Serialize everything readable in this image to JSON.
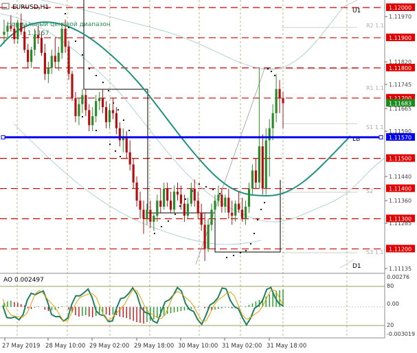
{
  "window": {
    "symbol_title": "EURUSD,H1",
    "indicator_line": "Нормальный ценовой диапазон",
    "price_readout": "1.1157"
  },
  "ao_panel": {
    "label": "AO 0.002497",
    "axis_labels": [
      "0.00276",
      "80",
      "0.00",
      "20",
      "-0.003019"
    ]
  },
  "chart_data": {
    "type": "candlestick",
    "title": "EURUSD,H1",
    "x_ticks": [
      "27 May 2019",
      "28 May 10:00",
      "29 May 02:00",
      "29 May 18:00",
      "30 May 10:00",
      "31 May 02:00",
      "31 May 18:00"
    ],
    "ylim": [
      1.11135,
      1.12
    ],
    "price_axis_labels": [
      "1.12000",
      "1.11970",
      "1.11900",
      "1.11820",
      "1.11800",
      "1.11745",
      "1.11700",
      "1.11683",
      "1.11665",
      "1.11590",
      "1.11570",
      "1.11500",
      "1.11440",
      "1.11400",
      "1.11360",
      "1.11300",
      "1.11285",
      "1.11200",
      "1.11135"
    ],
    "current_price": 1.11683,
    "levels": [
      {
        "name": "U1",
        "value": 1.12
      },
      {
        "name": "R2",
        "value": 1.1194
      },
      {
        "name": "R1",
        "value": 1.1174
      },
      {
        "name": "S1",
        "value": 1.1161
      },
      {
        "name": "LB",
        "value": 1.1157
      },
      {
        "name": "S2",
        "value": 1.1139
      },
      {
        "name": "S3",
        "value": 1.1119
      },
      {
        "name": "D1",
        "value": 1.1113
      }
    ],
    "level_short_labels": [
      "U1",
      "R2 1.1",
      "R1 1.1",
      "S1 1.1",
      "LB",
      "S2",
      "S3 1.1",
      "D1"
    ],
    "dashed_levels": [
      1.12,
      1.119,
      1.118,
      1.117,
      1.115,
      1.114,
      1.113,
      1.112
    ],
    "candles": [
      [
        1.1191,
        1.1196,
        1.1188,
        1.1192
      ],
      [
        1.1192,
        1.1195,
        1.119,
        1.1194
      ],
      [
        1.1194,
        1.11975,
        1.1192,
        1.1193
      ],
      [
        1.1193,
        1.1195,
        1.1188,
        1.11895
      ],
      [
        1.11895,
        1.1196,
        1.1188,
        1.1195
      ],
      [
        1.1195,
        1.1198,
        1.1191,
        1.1192
      ],
      [
        1.1192,
        1.1194,
        1.1185,
        1.1186
      ],
      [
        1.1186,
        1.1188,
        1.118,
        1.1182
      ],
      [
        1.1182,
        1.1187,
        1.118,
        1.1186
      ],
      [
        1.1186,
        1.1193,
        1.1184,
        1.1191
      ],
      [
        1.1191,
        1.1194,
        1.1188,
        1.119
      ],
      [
        1.119,
        1.1192,
        1.1184,
        1.1185
      ],
      [
        1.1185,
        1.1188,
        1.1176,
        1.1178
      ],
      [
        1.1178,
        1.1182,
        1.1175,
        1.118
      ],
      [
        1.118,
        1.1186,
        1.1178,
        1.1184
      ],
      [
        1.1184,
        1.119,
        1.118,
        1.1182
      ],
      [
        1.1182,
        1.1187,
        1.1179,
        1.1185
      ],
      [
        1.1185,
        1.1195,
        1.1183,
        1.1193
      ],
      [
        1.1193,
        1.1196,
        1.1185,
        1.1187
      ],
      [
        1.1187,
        1.1189,
        1.1176,
        1.1178
      ],
      [
        1.1178,
        1.1179,
        1.1169,
        1.117
      ],
      [
        1.117,
        1.1172,
        1.1162,
        1.1164
      ],
      [
        1.1164,
        1.117,
        1.1161,
        1.1168
      ],
      [
        1.1168,
        1.1173,
        1.1165,
        1.1171
      ],
      [
        1.1171,
        1.1173,
        1.1164,
        1.1166
      ],
      [
        1.1166,
        1.1168,
        1.1159,
        1.1161
      ],
      [
        1.1161,
        1.1167,
        1.1159,
        1.1164
      ],
      [
        1.1164,
        1.1171,
        1.1162,
        1.1169
      ],
      [
        1.1169,
        1.1172,
        1.1166,
        1.117
      ],
      [
        1.117,
        1.1173,
        1.1165,
        1.1167
      ],
      [
        1.1167,
        1.1169,
        1.116,
        1.1162
      ],
      [
        1.1162,
        1.1168,
        1.116,
        1.1166
      ],
      [
        1.1166,
        1.117,
        1.1163,
        1.1165
      ],
      [
        1.1165,
        1.1167,
        1.1158,
        1.116
      ],
      [
        1.116,
        1.1162,
        1.1154,
        1.1156
      ],
      [
        1.1156,
        1.116,
        1.1152,
        1.1157
      ],
      [
        1.1157,
        1.1159,
        1.115,
        1.1152
      ],
      [
        1.1152,
        1.1156,
        1.1146,
        1.1148
      ],
      [
        1.1148,
        1.115,
        1.114,
        1.1142
      ],
      [
        1.1142,
        1.1144,
        1.1134,
        1.1136
      ],
      [
        1.1136,
        1.1139,
        1.113,
        1.1133
      ],
      [
        1.1133,
        1.1136,
        1.1125,
        1.113
      ],
      [
        1.113,
        1.1135,
        1.1128,
        1.1133
      ],
      [
        1.1133,
        1.1136,
        1.1127,
        1.1129
      ],
      [
        1.1129,
        1.1132,
        1.1126,
        1.1131
      ],
      [
        1.1131,
        1.1138,
        1.1129,
        1.1136
      ],
      [
        1.1136,
        1.114,
        1.1132,
        1.1134
      ],
      [
        1.1134,
        1.1142,
        1.1133,
        1.114
      ],
      [
        1.114,
        1.1142,
        1.1134,
        1.1136
      ],
      [
        1.1136,
        1.1139,
        1.1132,
        1.1133
      ],
      [
        1.1133,
        1.1141,
        1.1132,
        1.1139
      ],
      [
        1.1139,
        1.1142,
        1.1136,
        1.1138
      ],
      [
        1.1138,
        1.1141,
        1.1133,
        1.1135
      ],
      [
        1.1135,
        1.1138,
        1.1129,
        1.1131
      ],
      [
        1.1131,
        1.1137,
        1.113,
        1.1135
      ],
      [
        1.1135,
        1.1142,
        1.1134,
        1.114
      ],
      [
        1.114,
        1.1143,
        1.1134,
        1.1136
      ],
      [
        1.1136,
        1.1139,
        1.113,
        1.1132
      ],
      [
        1.1132,
        1.1135,
        1.1126,
        1.1128
      ],
      [
        1.1128,
        1.1132,
        1.1116,
        1.112
      ],
      [
        1.112,
        1.113,
        1.1119,
        1.1128
      ],
      [
        1.1128,
        1.1135,
        1.1126,
        1.1133
      ],
      [
        1.1133,
        1.1138,
        1.113,
        1.1136
      ],
      [
        1.1136,
        1.1141,
        1.1134,
        1.1138
      ],
      [
        1.1138,
        1.114,
        1.1132,
        1.1134
      ],
      [
        1.1134,
        1.1138,
        1.1132,
        1.1137
      ],
      [
        1.1137,
        1.114,
        1.113,
        1.1132
      ],
      [
        1.1132,
        1.1136,
        1.1128,
        1.1131
      ],
      [
        1.1131,
        1.1136,
        1.1129,
        1.1135
      ],
      [
        1.1135,
        1.1139,
        1.1132,
        1.1133
      ],
      [
        1.1133,
        1.1137,
        1.1129,
        1.113
      ],
      [
        1.113,
        1.1136,
        1.1128,
        1.1134
      ],
      [
        1.1134,
        1.1142,
        1.1132,
        1.114
      ],
      [
        1.114,
        1.1148,
        1.1138,
        1.1146
      ],
      [
        1.1146,
        1.115,
        1.114,
        1.1142
      ],
      [
        1.1142,
        1.118,
        1.114,
        1.1154
      ],
      [
        1.1154,
        1.1158,
        1.1138,
        1.114
      ],
      [
        1.114,
        1.116,
        1.1138,
        1.1156
      ],
      [
        1.1156,
        1.1163,
        1.1144,
        1.116
      ],
      [
        1.116,
        1.1168,
        1.1156,
        1.1165
      ],
      [
        1.1165,
        1.1178,
        1.1162,
        1.1173
      ],
      [
        1.1173,
        1.1176,
        1.1165,
        1.117
      ],
      [
        1.117,
        1.1172,
        1.116,
        1.11683
      ]
    ],
    "ao_histogram": [
      0.0006,
      0.0008,
      0.0009,
      0.0007,
      0.0006,
      0.0004,
      0.0002,
      -0.0002,
      -0.0003,
      -0.0001,
      0.0001,
      0.0,
      -0.0004,
      -0.0006,
      -0.0005,
      -0.0004,
      -0.0002,
      0.0001,
      0.0,
      -0.0004,
      -0.0008,
      -0.0012,
      -0.0014,
      -0.0013,
      -0.0012,
      -0.0014,
      -0.0015,
      -0.0013,
      -0.0011,
      -0.001,
      -0.0011,
      -0.0012,
      -0.0011,
      -0.0012,
      -0.0014,
      -0.0015,
      -0.0016,
      -0.0018,
      -0.002,
      -0.0022,
      -0.0023,
      -0.0024,
      -0.0022,
      -0.002,
      -0.0018,
      -0.0016,
      -0.0014,
      -0.0012,
      -0.001,
      -0.0009,
      -0.0008,
      -0.0007,
      -0.0006,
      -0.0005,
      -0.0004,
      -0.0003,
      -0.0002,
      -0.0001,
      0.0,
      -0.0002,
      -0.0004,
      -0.0005,
      -0.0004,
      -0.0003,
      -0.0002,
      -0.0001,
      -0.0001,
      -0.0002,
      -0.0002,
      -0.0001,
      0.0,
      0.0001,
      0.0003,
      0.0005,
      0.0008,
      0.001,
      0.0012,
      0.0015,
      0.0018,
      0.0021,
      0.0023,
      0.0024,
      0.0025
    ]
  }
}
